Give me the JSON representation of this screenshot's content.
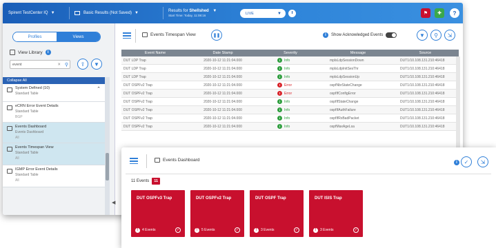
{
  "topbar": {
    "app_name": "Spirent TestCenter IQ",
    "dashboard": "Basic Results (Not Saved)",
    "results_for_label": "Results for",
    "results_for_value": "Shellshed",
    "results_since": "Start Time: Today, 11:08:16",
    "live_label": "LIVE",
    "help": "?"
  },
  "left_panel": {
    "tabs": [
      {
        "label": "Profiles",
        "active": false
      },
      {
        "label": "Views",
        "active": true
      }
    ],
    "view_library_label": "View Library",
    "search_value": "event",
    "collapse_all_label": "Collapse All",
    "items": [
      {
        "title": "System Defined (10)",
        "subtitle": "Standard Table",
        "meta": "",
        "selected": false
      },
      {
        "title": "eCRN Error Event Details",
        "subtitle": "Standard Table",
        "meta": "BGP",
        "selected": false
      },
      {
        "title": "Events Dashboard",
        "subtitle": "Events Dashboard",
        "meta": "All",
        "selected": true
      },
      {
        "title": "Events Timespan View",
        "subtitle": "Standard Table",
        "meta": "All",
        "selected": true
      },
      {
        "title": "IGMP Error Event Details",
        "subtitle": "Standard Table",
        "meta": "All",
        "selected": false
      }
    ]
  },
  "main_view": {
    "title": "Events Timespan View",
    "show_ack_label": "Show Acknowledged Events",
    "columns": [
      "Event Name",
      "Date Stamp",
      "Severity",
      "Message",
      "Source"
    ],
    "rows": [
      {
        "name": "DUT LDP Trap",
        "date": "2020-10-12 11:21:04.000",
        "severity": "Info",
        "level": "info",
        "message": "mplsLdpSessionDown",
        "source": "DUT1/10.108.131.210:46418"
      },
      {
        "name": "DUT LDP Trap",
        "date": "2020-10-12 11:21:04.000",
        "severity": "Info",
        "level": "info",
        "message": "mplsLdpInitSesThr",
        "source": "DUT1/10.108.131.210:46418"
      },
      {
        "name": "DUT LDP Trap",
        "date": "2020-10-12 11:21:04.000",
        "severity": "Info",
        "level": "info",
        "message": "mplsLdpSessionUp",
        "source": "DUT1/10.108.131.210:46418"
      },
      {
        "name": "DUT OSPFv2 Trap",
        "date": "2020-10-12 11:21:04.000",
        "severity": "Error",
        "level": "error",
        "message": "ospfNbrStateChange",
        "source": "DUT1/10.108.131.210:46418"
      },
      {
        "name": "DUT OSPFv2 Trap",
        "date": "2020-10-12 11:21:04.000",
        "severity": "Error",
        "level": "error",
        "message": "ospfIfConfigError",
        "source": "DUT1/10.108.131.210:46418"
      },
      {
        "name": "DUT OSPFv2 Trap",
        "date": "2020-10-12 11:21:04.000",
        "severity": "Info",
        "level": "info",
        "message": "ospfIfStateChange",
        "source": "DUT1/10.108.131.210:46418"
      },
      {
        "name": "DUT OSPFv2 Trap",
        "date": "2020-10-12 11:21:04.000",
        "severity": "Info",
        "level": "info",
        "message": "ospfIfAuthFailure",
        "source": "DUT1/10.108.131.210:46418"
      },
      {
        "name": "DUT OSPFv2 Trap",
        "date": "2020-10-12 11:21:04.000",
        "severity": "Info",
        "level": "info",
        "message": "ospfIfRxBadPacket",
        "source": "DUT1/10.108.131.210:46418"
      },
      {
        "name": "DUT OSPFv2 Trap",
        "date": "2020-10-12 11:21:04.000",
        "severity": "Info",
        "level": "info",
        "message": "ospfMaxAgeLsa",
        "source": "DUT1/10.108.131.210:46418"
      }
    ]
  },
  "dashboard": {
    "title": "Events Dashboard",
    "events_label": "11 Events",
    "events_badge": "11",
    "tiles": [
      {
        "name": "DUT OSPFv3 Trap",
        "count_label": "4 Events"
      },
      {
        "name": "DUT OSPFv2 Trap",
        "count_label": "5 Events"
      },
      {
        "name": "DUT OSPF Trap",
        "count_label": "3 Events"
      },
      {
        "name": "DUT ISIS Trap",
        "count_label": "3 Events"
      }
    ]
  },
  "colors": {
    "brand_blue": "#2f7fd8",
    "error_red": "#c8102e",
    "info_green": "#2e9e3e"
  }
}
